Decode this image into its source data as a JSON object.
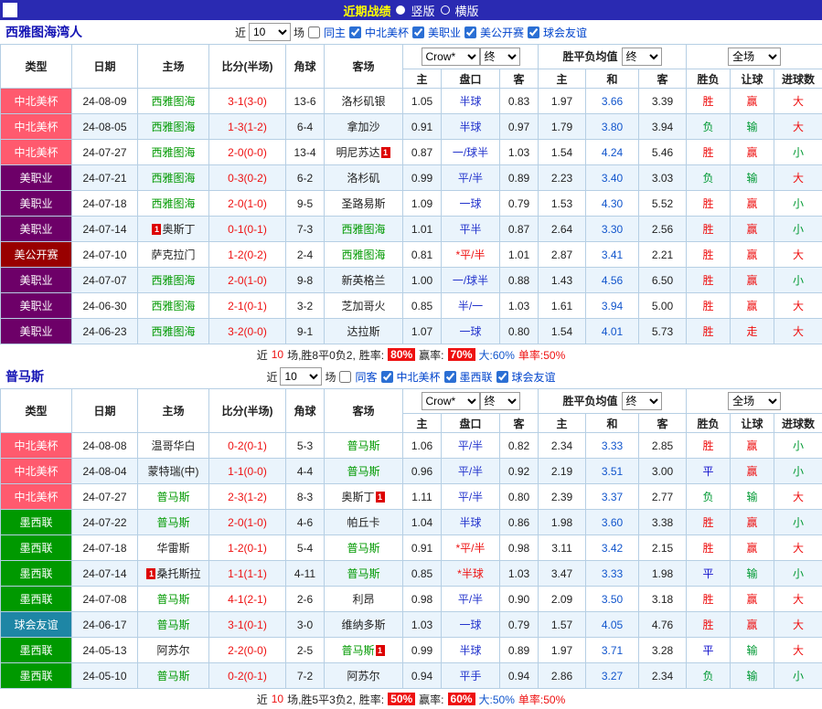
{
  "topbar": {
    "title": "近期战绩",
    "vertical": "竖版",
    "horizontal": "横版"
  },
  "colors": {
    "topbar_bg": "#2a2ab2",
    "title_yellow": "#ffff00",
    "border": "#b6cfe4",
    "row_alt": "#eaf4fc",
    "team_green": "#009900",
    "score_red": "#ee1111",
    "handicap_blue": "#2233cc",
    "avg_mid_blue": "#1155cc",
    "filter_blue": "#0044cc",
    "section_title_blue": "#1414b4",
    "leagues": {
      "中北美杯": "#ff5a6e",
      "美职业": "#6d0068",
      "美公开赛": "#990000",
      "墨西联": "#009900",
      "球会友谊": "#1e86a5"
    },
    "results": {
      "胜": "#ee1111",
      "负": "#009933",
      "平": "#1111cc",
      "赢": "#ee1111",
      "输": "#009933",
      "走": "#ee1111",
      "大": "#ee1111",
      "小": "#009933"
    }
  },
  "table_header": {
    "static_cols": [
      "类型",
      "日期",
      "主场",
      "比分(半场)",
      "角球",
      "客场"
    ],
    "odds_group": {
      "company_select": "Crow*",
      "time_select": "终",
      "cols": [
        "主",
        "盘口",
        "客"
      ]
    },
    "avg_group": {
      "label": "胜平负均值",
      "time_select": "终",
      "cols": [
        "主",
        "和",
        "客"
      ]
    },
    "full_group": {
      "scope_select": "全场",
      "cols": [
        "胜负",
        "让球",
        "进球数"
      ]
    }
  },
  "sections": [
    {
      "team": "西雅图海湾人",
      "filter": {
        "near": "近",
        "count": "10",
        "games": "场",
        "same": "同主",
        "same_checked": false,
        "leagues": [
          "中北美杯",
          "美职业",
          "美公开赛",
          "球会友谊"
        ]
      },
      "rows": [
        {
          "lg": "中北美杯",
          "dt": "24-08-09",
          "hm": "西雅图海",
          "hg": true,
          "sc": "3-1(3-0)",
          "cn": "13-6",
          "aw": "洛杉矶银",
          "ag": false,
          "o1": "1.05",
          "hc": "半球",
          "st": false,
          "o2": "0.83",
          "a1": "1.97",
          "a2": "3.66",
          "a3": "3.39",
          "r1": "胜",
          "r2": "赢",
          "r3": "大"
        },
        {
          "lg": "中北美杯",
          "dt": "24-08-05",
          "hm": "西雅图海",
          "hg": true,
          "sc": "1-3(1-2)",
          "cn": "6-4",
          "aw": "拿加沙",
          "ag": false,
          "o1": "0.91",
          "hc": "半球",
          "st": false,
          "o2": "0.97",
          "a1": "1.79",
          "a2": "3.80",
          "a3": "3.94",
          "r1": "负",
          "r2": "输",
          "r3": "大"
        },
        {
          "lg": "中北美杯",
          "dt": "24-07-27",
          "hm": "西雅图海",
          "hg": true,
          "sc": "2-0(0-0)",
          "cn": "13-4",
          "aw": "明尼苏达",
          "ag": false,
          "arc": "after",
          "o1": "0.87",
          "hc": "一/球半",
          "st": false,
          "o2": "1.03",
          "a1": "1.54",
          "a2": "4.24",
          "a3": "5.46",
          "r1": "胜",
          "r2": "赢",
          "r3": "小"
        },
        {
          "lg": "美职业",
          "dt": "24-07-21",
          "hm": "西雅图海",
          "hg": true,
          "sc": "0-3(0-2)",
          "cn": "6-2",
          "aw": "洛杉矶",
          "ag": false,
          "o1": "0.99",
          "hc": "平/半",
          "st": false,
          "o2": "0.89",
          "a1": "2.23",
          "a2": "3.40",
          "a3": "3.03",
          "r1": "负",
          "r2": "输",
          "r3": "大"
        },
        {
          "lg": "美职业",
          "dt": "24-07-18",
          "hm": "西雅图海",
          "hg": true,
          "sc": "2-0(1-0)",
          "cn": "9-5",
          "aw": "圣路易斯",
          "ag": false,
          "o1": "1.09",
          "hc": "一球",
          "st": false,
          "o2": "0.79",
          "a1": "1.53",
          "a2": "4.30",
          "a3": "5.52",
          "r1": "胜",
          "r2": "赢",
          "r3": "小"
        },
        {
          "lg": "美职业",
          "dt": "24-07-14",
          "hm": "奥斯丁",
          "hg": false,
          "hrc": "before",
          "sc": "0-1(0-1)",
          "cn": "7-3",
          "aw": "西雅图海",
          "ag": true,
          "o1": "1.01",
          "hc": "平半",
          "st": false,
          "o2": "0.87",
          "a1": "2.64",
          "a2": "3.30",
          "a3": "2.56",
          "r1": "胜",
          "r2": "赢",
          "r3": "小"
        },
        {
          "lg": "美公开赛",
          "dt": "24-07-10",
          "hm": "萨克拉门",
          "hg": false,
          "sc": "1-2(0-2)",
          "cn": "2-4",
          "aw": "西雅图海",
          "ag": true,
          "o1": "0.81",
          "hc": "*平/半",
          "st": true,
          "o2": "1.01",
          "a1": "2.87",
          "a2": "3.41",
          "a3": "2.21",
          "r1": "胜",
          "r2": "赢",
          "r3": "大"
        },
        {
          "lg": "美职业",
          "dt": "24-07-07",
          "hm": "西雅图海",
          "hg": true,
          "sc": "2-0(1-0)",
          "cn": "9-8",
          "aw": "新英格兰",
          "ag": false,
          "o1": "1.00",
          "hc": "一/球半",
          "st": false,
          "o2": "0.88",
          "a1": "1.43",
          "a2": "4.56",
          "a3": "6.50",
          "r1": "胜",
          "r2": "赢",
          "r3": "小"
        },
        {
          "lg": "美职业",
          "dt": "24-06-30",
          "hm": "西雅图海",
          "hg": true,
          "sc": "2-1(0-1)",
          "cn": "3-2",
          "aw": "芝加哥火",
          "ag": false,
          "o1": "0.85",
          "hc": "半/一",
          "st": false,
          "o2": "1.03",
          "a1": "1.61",
          "a2": "3.94",
          "a3": "5.00",
          "r1": "胜",
          "r2": "赢",
          "r3": "大"
        },
        {
          "lg": "美职业",
          "dt": "24-06-23",
          "hm": "西雅图海",
          "hg": true,
          "sc": "3-2(0-0)",
          "cn": "9-1",
          "aw": "达拉斯",
          "ag": false,
          "o1": "1.07",
          "hc": "一球",
          "st": false,
          "o2": "0.80",
          "a1": "1.54",
          "a2": "4.01",
          "a3": "5.73",
          "r1": "胜",
          "r2": "走",
          "r3": "大"
        }
      ],
      "footer": {
        "pre": "近",
        "count": "10",
        "mid": "场,胜8平0负2,",
        "win_label": "胜率:",
        "win": "80%",
        "odds_label": "赢率:",
        "odds": "70%",
        "over": "大:60%",
        "single": "单率:50%"
      }
    },
    {
      "team": "普马斯",
      "filter": {
        "near": "近",
        "count": "10",
        "games": "场",
        "same": "同客",
        "same_checked": false,
        "leagues": [
          "中北美杯",
          "墨西联",
          "球会友谊"
        ]
      },
      "rows": [
        {
          "lg": "中北美杯",
          "dt": "24-08-08",
          "hm": "温哥华白",
          "hg": false,
          "sc": "0-2(0-1)",
          "cn": "5-3",
          "aw": "普马斯",
          "ag": true,
          "o1": "1.06",
          "hc": "平/半",
          "st": false,
          "o2": "0.82",
          "a1": "2.34",
          "a2": "3.33",
          "a3": "2.85",
          "r1": "胜",
          "r2": "赢",
          "r3": "小"
        },
        {
          "lg": "中北美杯",
          "dt": "24-08-04",
          "hm": "蒙特瑞(中)",
          "hg": false,
          "sc": "1-1(0-0)",
          "cn": "4-4",
          "aw": "普马斯",
          "ag": true,
          "o1": "0.96",
          "hc": "平/半",
          "st": false,
          "o2": "0.92",
          "a1": "2.19",
          "a2": "3.51",
          "a3": "3.00",
          "r1": "平",
          "r2": "赢",
          "r3": "小"
        },
        {
          "lg": "中北美杯",
          "dt": "24-07-27",
          "hm": "普马斯",
          "hg": true,
          "sc": "2-3(1-2)",
          "cn": "8-3",
          "aw": "奥斯丁",
          "ag": false,
          "arc": "after",
          "o1": "1.11",
          "hc": "平/半",
          "st": false,
          "o2": "0.80",
          "a1": "2.39",
          "a2": "3.37",
          "a3": "2.77",
          "r1": "负",
          "r2": "输",
          "r3": "大"
        },
        {
          "lg": "墨西联",
          "dt": "24-07-22",
          "hm": "普马斯",
          "hg": true,
          "sc": "2-0(1-0)",
          "cn": "4-6",
          "aw": "帕丘卡",
          "ag": false,
          "o1": "1.04",
          "hc": "半球",
          "st": false,
          "o2": "0.86",
          "a1": "1.98",
          "a2": "3.60",
          "a3": "3.38",
          "r1": "胜",
          "r2": "赢",
          "r3": "小"
        },
        {
          "lg": "墨西联",
          "dt": "24-07-18",
          "hm": "华雷斯",
          "hg": false,
          "sc": "1-2(0-1)",
          "cn": "5-4",
          "aw": "普马斯",
          "ag": true,
          "o1": "0.91",
          "hc": "*平/半",
          "st": true,
          "o2": "0.98",
          "a1": "3.11",
          "a2": "3.42",
          "a3": "2.15",
          "r1": "胜",
          "r2": "赢",
          "r3": "大"
        },
        {
          "lg": "墨西联",
          "dt": "24-07-14",
          "hm": "桑托斯拉",
          "hg": false,
          "hrc": "before",
          "sc": "1-1(1-1)",
          "cn": "4-11",
          "aw": "普马斯",
          "ag": true,
          "o1": "0.85",
          "hc": "*半球",
          "st": true,
          "o2": "1.03",
          "a1": "3.47",
          "a2": "3.33",
          "a3": "1.98",
          "r1": "平",
          "r2": "输",
          "r3": "小"
        },
        {
          "lg": "墨西联",
          "dt": "24-07-08",
          "hm": "普马斯",
          "hg": true,
          "sc": "4-1(2-1)",
          "cn": "2-6",
          "aw": "利昂",
          "ag": false,
          "o1": "0.98",
          "hc": "平/半",
          "st": false,
          "o2": "0.90",
          "a1": "2.09",
          "a2": "3.50",
          "a3": "3.18",
          "r1": "胜",
          "r2": "赢",
          "r3": "大"
        },
        {
          "lg": "球会友谊",
          "dt": "24-06-17",
          "hm": "普马斯",
          "hg": true,
          "sc": "3-1(0-1)",
          "cn": "3-0",
          "aw": "维纳多斯",
          "ag": false,
          "o1": "1.03",
          "hc": "一球",
          "st": false,
          "o2": "0.79",
          "a1": "1.57",
          "a2": "4.05",
          "a3": "4.76",
          "r1": "胜",
          "r2": "赢",
          "r3": "大"
        },
        {
          "lg": "墨西联",
          "dt": "24-05-13",
          "hm": "阿苏尔",
          "hg": false,
          "sc": "2-2(0-0)",
          "cn": "2-5",
          "aw": "普马斯",
          "ag": true,
          "arc": "after",
          "o1": "0.99",
          "hc": "半球",
          "st": false,
          "o2": "0.89",
          "a1": "1.97",
          "a2": "3.71",
          "a3": "3.28",
          "r1": "平",
          "r2": "输",
          "r3": "大"
        },
        {
          "lg": "墨西联",
          "dt": "24-05-10",
          "hm": "普马斯",
          "hg": true,
          "sc": "0-2(0-1)",
          "cn": "7-2",
          "aw": "阿苏尔",
          "ag": false,
          "o1": "0.94",
          "hc": "平手",
          "st": false,
          "o2": "0.94",
          "a1": "2.86",
          "a2": "3.27",
          "a3": "2.34",
          "r1": "负",
          "r2": "输",
          "r3": "小"
        }
      ],
      "footer": {
        "pre": "近",
        "count": "10",
        "mid": "场,胜5平3负2,",
        "win_label": "胜率:",
        "win": "50%",
        "odds_label": "赢率:",
        "odds": "60%",
        "over": "大:50%",
        "single": "单率:50%"
      }
    }
  ]
}
